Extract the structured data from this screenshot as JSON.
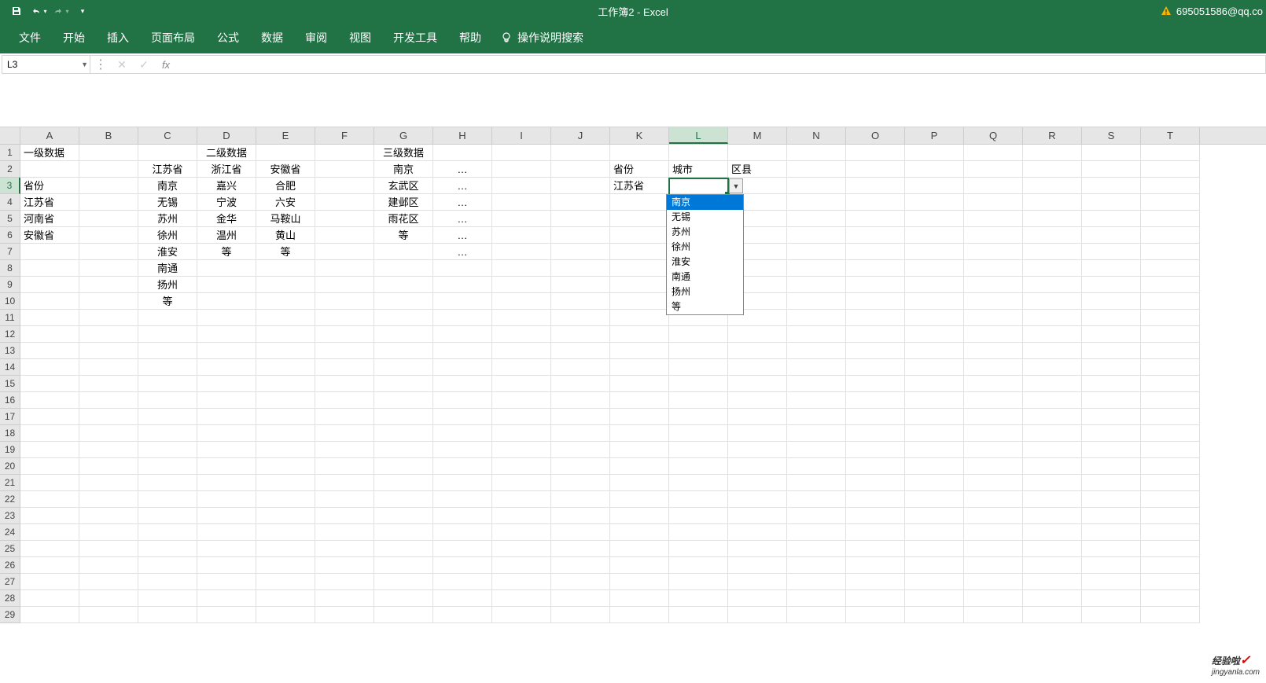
{
  "title": "工作簿2 - Excel",
  "user": "695051586@qq.co",
  "nameBox": "L3",
  "formula": "",
  "ribbon": {
    "tabs": [
      "文件",
      "开始",
      "插入",
      "页面布局",
      "公式",
      "数据",
      "审阅",
      "视图",
      "开发工具",
      "帮助"
    ],
    "tellMe": "操作说明搜索"
  },
  "columns": [
    "A",
    "B",
    "C",
    "D",
    "E",
    "F",
    "G",
    "H",
    "I",
    "J",
    "K",
    "L",
    "M",
    "N",
    "O",
    "P",
    "Q",
    "R",
    "S",
    "T"
  ],
  "selectedCol": "L",
  "selectedRow": 3,
  "rowCount": 29,
  "cells": {
    "A1": "一级数据",
    "D1": "二级数据",
    "G1": "三级数据",
    "A3": "省份",
    "A4": "江苏省",
    "A5": "河南省",
    "A6": "安徽省",
    "C2": "江苏省",
    "D2": "浙江省",
    "E2": "安徽省",
    "C3": "南京",
    "D3": "嘉兴",
    "E3": "合肥",
    "C4": "无锡",
    "D4": "宁波",
    "E4": "六安",
    "C5": "苏州",
    "D5": "金华",
    "E5": "马鞍山",
    "C6": "徐州",
    "D6": "温州",
    "E6": "黄山",
    "C7": "淮安",
    "D7": "等",
    "E7": "等",
    "C8": "南通",
    "C9": "扬州",
    "C10": "等",
    "G2": "南京",
    "H2": "…",
    "G3": "玄武区",
    "H3": "…",
    "G4": "建邺区",
    "H4": "…",
    "G5": "雨花区",
    "H5": "…",
    "G6": "等",
    "H6": "…",
    "H7": "…",
    "K2": "省份",
    "L2": "城市",
    "M2": "区县",
    "K3": "江苏省"
  },
  "dropdown": {
    "items": [
      "南京",
      "无锡",
      "苏州",
      "徐州",
      "淮安",
      "南通",
      "扬州",
      "等"
    ],
    "highlighted": "南京"
  },
  "watermark": {
    "brand": "经验啦",
    "url": "jingyanla.com"
  }
}
